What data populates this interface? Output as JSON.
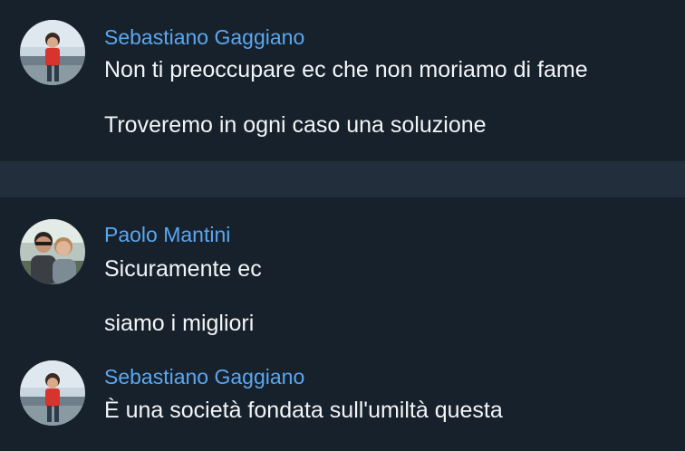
{
  "colors": {
    "background": "#17212b",
    "separator": "#232e3c",
    "sender_name": "#5aa7f0",
    "message_text": "#f2f5f8"
  },
  "groups": [
    {
      "sender": "Sebastiano Gaggiano",
      "avatar": "sebastiano-avatar",
      "messages": [
        "Non ti preoccupare ec che non moriamo di fame",
        "Troveremo in ogni caso una soluzione"
      ]
    },
    {
      "sender": "Paolo Mantini",
      "avatar": "paolo-avatar",
      "messages": [
        "Sicuramente ec",
        "siamo i migliori"
      ]
    },
    {
      "sender": "Sebastiano Gaggiano",
      "avatar": "sebastiano-avatar",
      "messages": [
        "È una società fondata sull'umiltà questa"
      ]
    }
  ]
}
